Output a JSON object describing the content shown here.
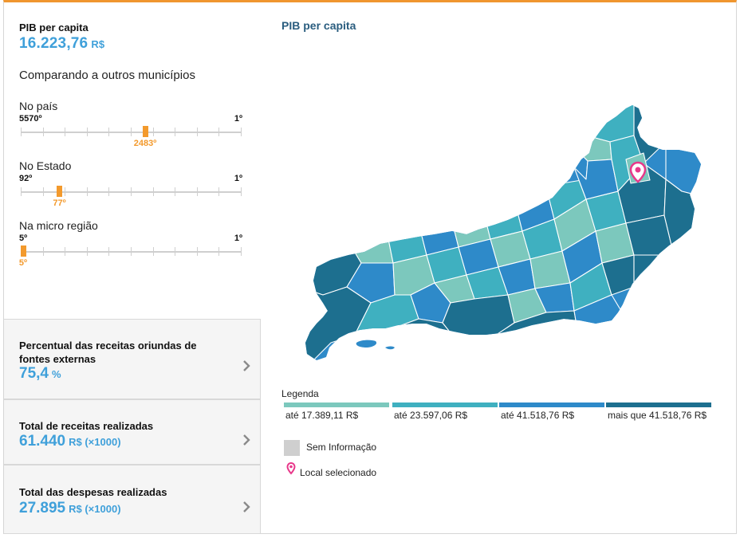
{
  "pib": {
    "title": "PIB per capita",
    "value": "16.223,76",
    "unit": "R$"
  },
  "compare_title": "Comparando a outros municípios",
  "ranks": [
    {
      "label": "No país",
      "left": "5570º",
      "right": "1º",
      "marker": "2483º",
      "position": 0.5543
    },
    {
      "label": "No Estado",
      "left": "92º",
      "right": "1º",
      "marker": "77º",
      "position": 0.1648
    },
    {
      "label": "Na micro região",
      "left": "5º",
      "right": "1º",
      "marker": "5º",
      "position": 0.0
    }
  ],
  "cards": [
    {
      "title": "Percentual das receitas oriundas de fontes externas",
      "value": "75,4",
      "unit": "%"
    },
    {
      "title": "Total de receitas realizadas",
      "value": "61.440",
      "unit": "R$ (×1000)"
    },
    {
      "title": "Total das despesas realizadas",
      "value": "27.895",
      "unit": "R$ (×1000)"
    }
  ],
  "map": {
    "title": "PIB per capita",
    "colors": {
      "c1": "#7cc8bd",
      "c2": "#3fb0c0",
      "c3": "#2e8ac9",
      "c4": "#1d6f8f",
      "pin": "#e8388a",
      "accent": "#f0962f"
    }
  },
  "legend": {
    "title": "Legenda",
    "items": [
      {
        "label": "até 17.389,11 R$",
        "color": "#7cc8bd"
      },
      {
        "label": "até 23.597,06 R$",
        "color": "#3fb0c0"
      },
      {
        "label": "até 41.518,76 R$",
        "color": "#2e8ac9"
      },
      {
        "label": "mais que 41.518,76 R$",
        "color": "#1d6f8f"
      }
    ],
    "no_info": "Sem Informação",
    "selected": "Local selecionado"
  }
}
